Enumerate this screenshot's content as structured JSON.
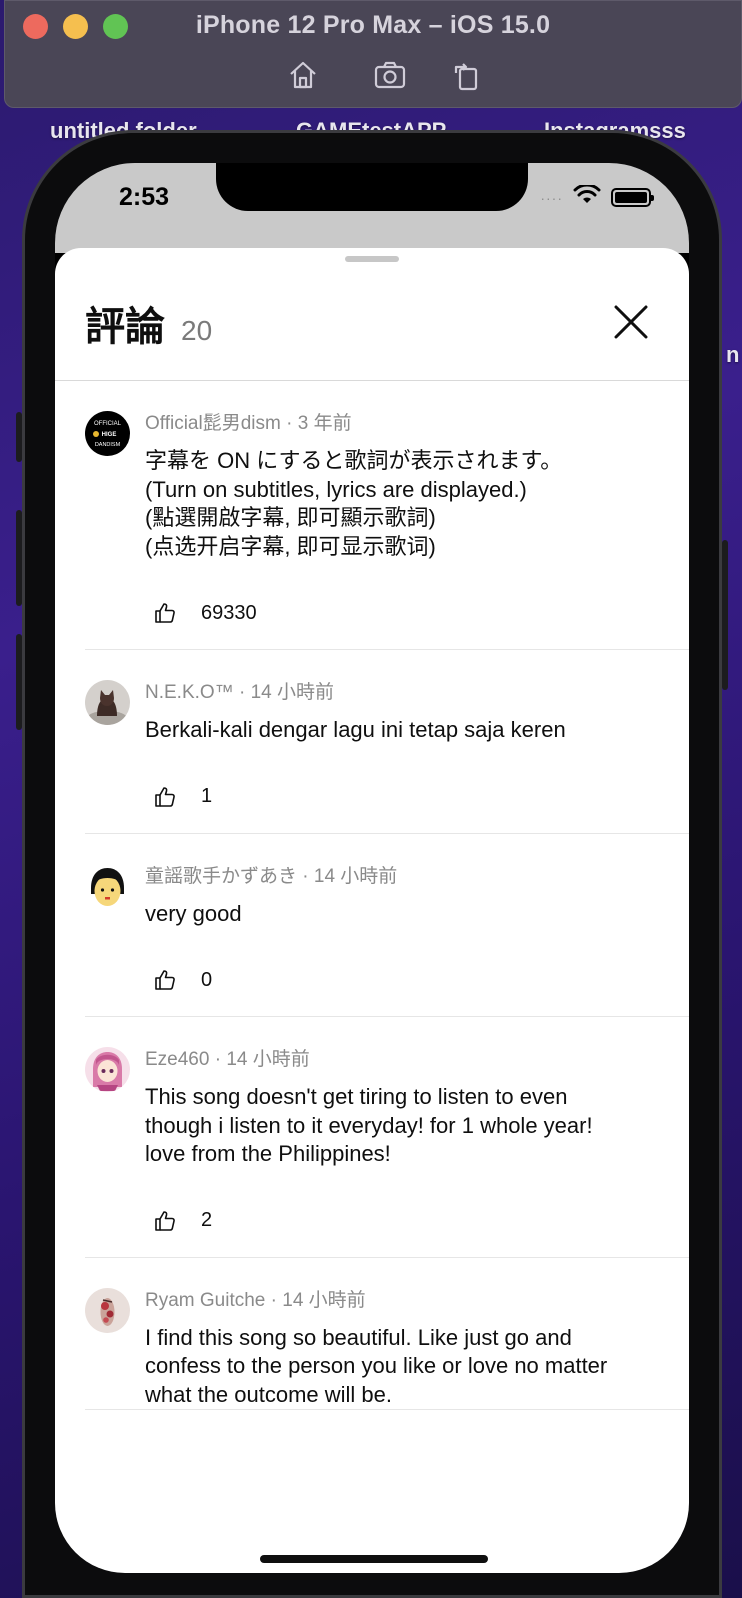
{
  "simulator": {
    "title": "iPhone 12 Pro Max – iOS 15.0",
    "tools": [
      "home-icon",
      "screenshot-icon",
      "rotate-icon"
    ]
  },
  "desktop": {
    "labels": [
      "untitled folder",
      "GAMEtestAPP",
      "Instagramsss"
    ],
    "edge_letter": "n"
  },
  "status_bar": {
    "time": "2:53",
    "signal": "····"
  },
  "sheet": {
    "title": "評論",
    "count": "20"
  },
  "comments": [
    {
      "author": "Official髭男dism",
      "time": "3 年前",
      "meta": "Official髭男dism · 3 年前",
      "text": "字幕を ON にすると歌詞が表示されます。\n(Turn on subtitles, lyrics are displayed.)\n(點選開啟字幕, 即可顯示歌詞)\n(点选开启字幕, 即可显示歌词)",
      "likes": "69330",
      "avatar_lines": [
        "OFFICIAL",
        "HIGE",
        "DANDISM"
      ]
    },
    {
      "author": "N.E.K.O™",
      "time": "14 小時前",
      "meta": "N.E.K.O™ · 14 小時前",
      "text": "Berkali-kali dengar lagu ini tetap saja keren",
      "likes": "1"
    },
    {
      "author": "童謡歌手かずあき",
      "time": "14 小時前",
      "meta": "童謡歌手かずあき · 14 小時前",
      "text": "very good",
      "likes": "0"
    },
    {
      "author": "Eze460",
      "time": "14 小時前",
      "meta": "Eze460 · 14 小時前",
      "text": "This song doesn't get tiring to listen to even\nthough i listen to it everyday! for 1 whole year!\nlove from the Philippines!",
      "likes": "2"
    },
    {
      "author": "Ryam Guitche",
      "time": "14 小時前",
      "meta": "Ryam Guitche · 14 小時前",
      "text": "I find this song so beautiful. Like just go and\nconfess to the person you like or love no matter\nwhat the outcome will be.",
      "likes": ""
    }
  ],
  "colors": {
    "accent_text": "#0f0f0f",
    "meta_text": "#8a8a8a",
    "sheet_bg": "#ffffff"
  }
}
